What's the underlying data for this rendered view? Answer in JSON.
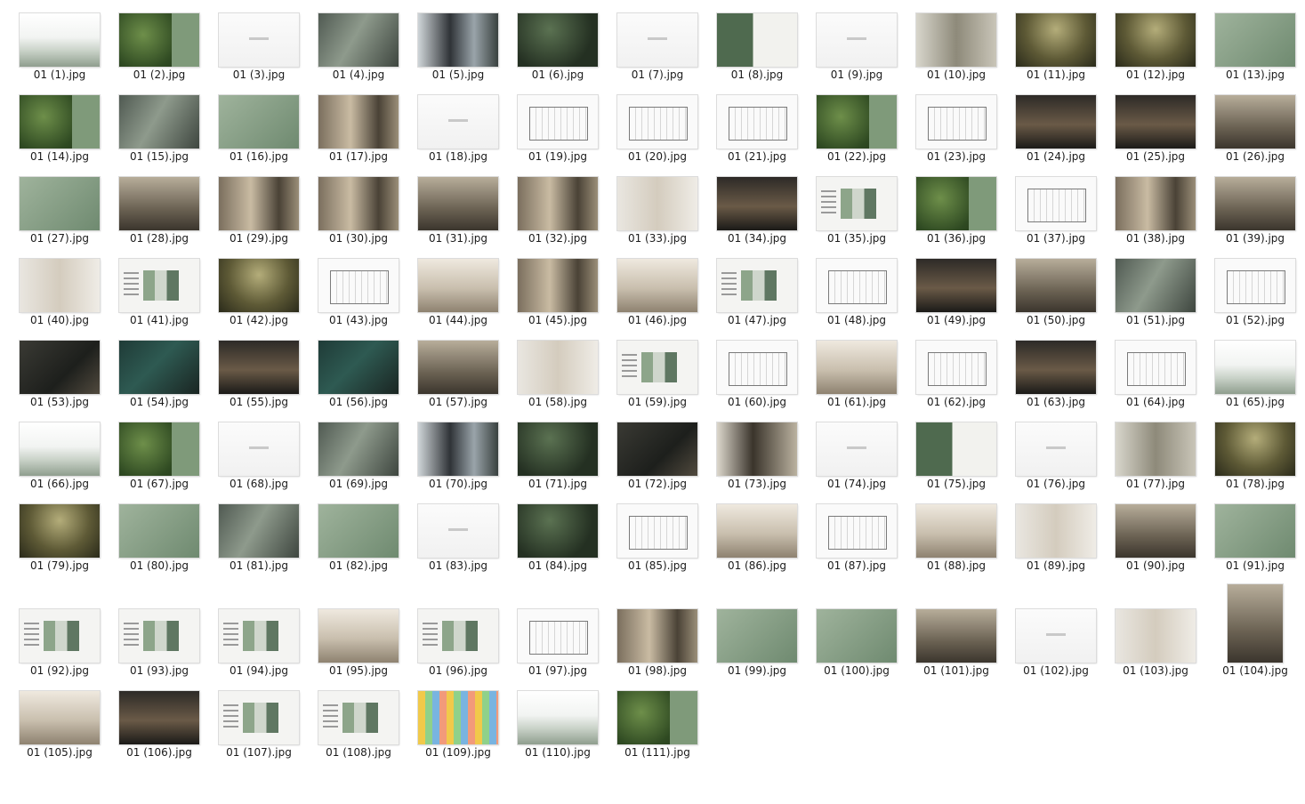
{
  "files": [
    {
      "label": "01 (1).jpg",
      "thumb": "fog"
    },
    {
      "label": "01 (2).jpg",
      "thumb": "forest"
    },
    {
      "label": "01 (3).jpg",
      "thumb": "blank"
    },
    {
      "label": "01 (4).jpg",
      "thumb": "aerial"
    },
    {
      "label": "01 (5).jpg",
      "thumb": "people"
    },
    {
      "label": "01 (6).jpg",
      "thumb": "darkgreen"
    },
    {
      "label": "01 (7).jpg",
      "thumb": "blank"
    },
    {
      "label": "01 (8).jpg",
      "thumb": "hotelcard"
    },
    {
      "label": "01 (9).jpg",
      "thumb": "blank"
    },
    {
      "label": "01 (10).jpg",
      "thumb": "history"
    },
    {
      "label": "01 (11).jpg",
      "thumb": "tree"
    },
    {
      "label": "01 (12).jpg",
      "thumb": "tree"
    },
    {
      "label": "01 (13).jpg",
      "thumb": "green"
    },
    {
      "label": "01 (14).jpg",
      "thumb": "forest"
    },
    {
      "label": "01 (15).jpg",
      "thumb": "aerial"
    },
    {
      "label": "01 (16).jpg",
      "thumb": "green"
    },
    {
      "label": "01 (17).jpg",
      "thumb": "interior"
    },
    {
      "label": "01 (18).jpg",
      "thumb": "blank"
    },
    {
      "label": "01 (19).jpg",
      "thumb": "plan"
    },
    {
      "label": "01 (20).jpg",
      "thumb": "plan"
    },
    {
      "label": "01 (21).jpg",
      "thumb": "plan"
    },
    {
      "label": "01 (22).jpg",
      "thumb": "forest"
    },
    {
      "label": "01 (23).jpg",
      "thumb": "plan"
    },
    {
      "label": "01 (24).jpg",
      "thumb": "night"
    },
    {
      "label": "01 (25).jpg",
      "thumb": "night"
    },
    {
      "label": "01 (26).jpg",
      "thumb": "lobby"
    },
    {
      "label": "01 (27).jpg",
      "thumb": "green"
    },
    {
      "label": "01 (28).jpg",
      "thumb": "lobby"
    },
    {
      "label": "01 (29).jpg",
      "thumb": "interior"
    },
    {
      "label": "01 (30).jpg",
      "thumb": "interior"
    },
    {
      "label": "01 (31).jpg",
      "thumb": "lobby"
    },
    {
      "label": "01 (32).jpg",
      "thumb": "interior"
    },
    {
      "label": "01 (33).jpg",
      "thumb": "product"
    },
    {
      "label": "01 (34).jpg",
      "thumb": "night"
    },
    {
      "label": "01 (35).jpg",
      "thumb": "board"
    },
    {
      "label": "01 (36).jpg",
      "thumb": "forest"
    },
    {
      "label": "01 (37).jpg",
      "thumb": "plan"
    },
    {
      "label": "01 (38).jpg",
      "thumb": "interior"
    },
    {
      "label": "01 (39).jpg",
      "thumb": "lobby"
    },
    {
      "label": "01 (40).jpg",
      "thumb": "product"
    },
    {
      "label": "01 (41).jpg",
      "thumb": "board"
    },
    {
      "label": "01 (42).jpg",
      "thumb": "tree"
    },
    {
      "label": "01 (43).jpg",
      "thumb": "plan"
    },
    {
      "label": "01 (44).jpg",
      "thumb": "room"
    },
    {
      "label": "01 (45).jpg",
      "thumb": "interior"
    },
    {
      "label": "01 (46).jpg",
      "thumb": "room"
    },
    {
      "label": "01 (47).jpg",
      "thumb": "board"
    },
    {
      "label": "01 (48).jpg",
      "thumb": "plan"
    },
    {
      "label": "01 (49).jpg",
      "thumb": "night"
    },
    {
      "label": "01 (50).jpg",
      "thumb": "lobby"
    },
    {
      "label": "01 (51).jpg",
      "thumb": "aerial"
    },
    {
      "label": "01 (52).jpg",
      "thumb": "plan"
    },
    {
      "label": "01 (53).jpg",
      "thumb": "dark"
    },
    {
      "label": "01 (54).jpg",
      "thumb": "tealdark"
    },
    {
      "label": "01 (55).jpg",
      "thumb": "night"
    },
    {
      "label": "01 (56).jpg",
      "thumb": "tealdark"
    },
    {
      "label": "01 (57).jpg",
      "thumb": "lobby"
    },
    {
      "label": "01 (58).jpg",
      "thumb": "product"
    },
    {
      "label": "01 (59).jpg",
      "thumb": "board"
    },
    {
      "label": "01 (60).jpg",
      "thumb": "plan"
    },
    {
      "label": "01 (61).jpg",
      "thumb": "room"
    },
    {
      "label": "01 (62).jpg",
      "thumb": "plan"
    },
    {
      "label": "01 (63).jpg",
      "thumb": "night"
    },
    {
      "label": "01 (64).jpg",
      "thumb": "plan"
    },
    {
      "label": "01 (65).jpg",
      "thumb": "fog"
    },
    {
      "label": "01 (66).jpg",
      "thumb": "fog"
    },
    {
      "label": "01 (67).jpg",
      "thumb": "forest"
    },
    {
      "label": "01 (68).jpg",
      "thumb": "blank"
    },
    {
      "label": "01 (69).jpg",
      "thumb": "aerial"
    },
    {
      "label": "01 (70).jpg",
      "thumb": "people"
    },
    {
      "label": "01 (71).jpg",
      "thumb": "darkgreen"
    },
    {
      "label": "01 (72).jpg",
      "thumb": "dark"
    },
    {
      "label": "01 (73).jpg",
      "thumb": "chinese"
    },
    {
      "label": "01 (74).jpg",
      "thumb": "blank"
    },
    {
      "label": "01 (75).jpg",
      "thumb": "hotelcard"
    },
    {
      "label": "01 (76).jpg",
      "thumb": "blank"
    },
    {
      "label": "01 (77).jpg",
      "thumb": "history"
    },
    {
      "label": "01 (78).jpg",
      "thumb": "tree"
    },
    {
      "label": "01 (79).jpg",
      "thumb": "tree"
    },
    {
      "label": "01 (80).jpg",
      "thumb": "green"
    },
    {
      "label": "01 (81).jpg",
      "thumb": "aerial"
    },
    {
      "label": "01 (82).jpg",
      "thumb": "green"
    },
    {
      "label": "01 (83).jpg",
      "thumb": "blank"
    },
    {
      "label": "01 (84).jpg",
      "thumb": "darkgreen"
    },
    {
      "label": "01 (85).jpg",
      "thumb": "plan"
    },
    {
      "label": "01 (86).jpg",
      "thumb": "room"
    },
    {
      "label": "01 (87).jpg",
      "thumb": "plan"
    },
    {
      "label": "01 (88).jpg",
      "thumb": "room"
    },
    {
      "label": "01 (89).jpg",
      "thumb": "product"
    },
    {
      "label": "01 (90).jpg",
      "thumb": "lobby"
    },
    {
      "label": "01 (91).jpg",
      "thumb": "green"
    },
    {
      "label": "01 (92).jpg",
      "thumb": "board"
    },
    {
      "label": "01 (93).jpg",
      "thumb": "board"
    },
    {
      "label": "01 (94).jpg",
      "thumb": "board"
    },
    {
      "label": "01 (95).jpg",
      "thumb": "room"
    },
    {
      "label": "01 (96).jpg",
      "thumb": "board"
    },
    {
      "label": "01 (97).jpg",
      "thumb": "plan"
    },
    {
      "label": "01 (98).jpg",
      "thumb": "interior"
    },
    {
      "label": "01 (99).jpg",
      "thumb": "green"
    },
    {
      "label": "01 (100).jpg",
      "thumb": "green"
    },
    {
      "label": "01 (101).jpg",
      "thumb": "lobby"
    },
    {
      "label": "01 (102).jpg",
      "thumb": "blank"
    },
    {
      "label": "01 (103).jpg",
      "thumb": "product"
    },
    {
      "label": "01 (104).jpg",
      "thumb": "lobby"
    },
    {
      "label": "01 (105).jpg",
      "thumb": "room"
    },
    {
      "label": "01 (106).jpg",
      "thumb": "night"
    },
    {
      "label": "01 (107).jpg",
      "thumb": "board"
    },
    {
      "label": "01 (108).jpg",
      "thumb": "board"
    },
    {
      "label": "01 (109).jpg",
      "thumb": "colorful"
    },
    {
      "label": "01 (110).jpg",
      "thumb": "fog"
    },
    {
      "label": "01 (111).jpg",
      "thumb": "forest"
    }
  ]
}
